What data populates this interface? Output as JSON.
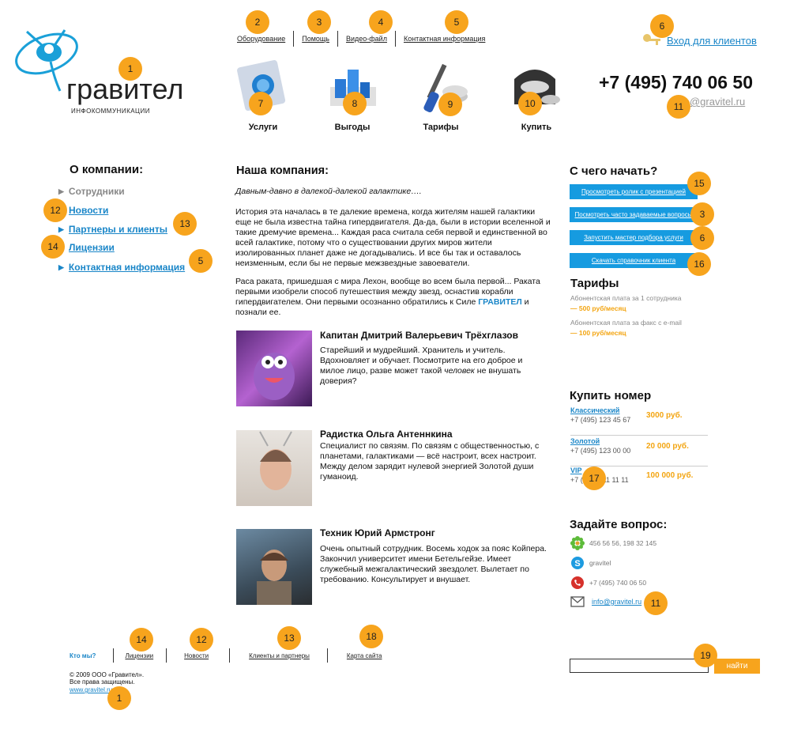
{
  "top_nav": [
    "Оборудование",
    "Помощь",
    "Видео-файл",
    "Контактная информация"
  ],
  "client_login": "Вход для клиентов",
  "logo": {
    "name": "гравител",
    "tagline": "ИНФОКОММУНИКАЦИИ"
  },
  "phone": "+7 (495) 740 06 50",
  "email_header": "info@gravitel.ru",
  "big_icons": [
    "Услуги",
    "Выгоды",
    "Тарифы",
    "Купить"
  ],
  "left_menu": {
    "title": "О компании:",
    "items": [
      "Сотрудники",
      "Новости",
      "Партнеры и клиенты",
      "Лицензии",
      "Контактная информация"
    ]
  },
  "main": {
    "title": "Наша компания:",
    "intro": "Давным-давно в далекой-далекой галактике….",
    "para1": "История эта началась в те далекие времена, когда жителям нашей галактики еще не была известна тайна гипердвигателя. Да-да, были в истории вселенной и такие дремучие времена... Каждая раса считала себя первой и единственной во всей галактике, потому что о существовании других миров жители изолированных планет даже не догадывались. И все бы так и оставалось неизменным, если бы не первые межзвездные завоеватели.",
    "para2_start": "Раса раката, пришедшая с мира Лехон, вообще во всем была первой... Раката первыми изобрели способ путешествия между звезд, оснастив корабли гипердвигателем. Они первыми осознанно обратились к Силе ",
    "para2_brand": "ГРАВИТЕЛ",
    "para2_end": " и познали ее.",
    "people": [
      {
        "name": "Капитан Дмитрий Валерьевич Трёхглазов",
        "text_a": "Старейший и мудрейший. Хранитель и учитель. Вдохновляет и обучает. Посмотрите на его доброе и милое лицо, разве может такой ",
        "text_em": "человек",
        "text_b": " не внушать доверия?"
      },
      {
        "name": "Радистка Ольга Антеннкина",
        "text_a": "Специалист по связям. По связям с общественностью, с планетами, галактиками — всё настроит, всех настроит. Между делом зарядит нулевой энергией  Золотой души гуманоид.",
        "text_em": "",
        "text_b": ""
      },
      {
        "name": "Техник Юрий Армстронг",
        "text_a": "Очень опытный сотрудник. Восемь ходок за пояс Койпера. Закончил университет имени Бетельгейзе. Имеет служебный межгалактический звездолет. Вылетает по требованию. Консультирует и внушает.",
        "text_em": "",
        "text_b": ""
      }
    ]
  },
  "right": {
    "start_title": "С чего начать?",
    "buttons": [
      "Просмотреть ролик с презентацией",
      "Посмотреть часто задаваемые вопросы",
      "Запустить мастер подбора услуги",
      "Скачать справочник клиента"
    ],
    "tariffs_title": "Тарифы",
    "tariffs": [
      {
        "label": "Абонентская плата за 1 сотрудника",
        "price": "— 500 руб/месяц"
      },
      {
        "label": "Абонентская плата за факс с e-mail",
        "price": "— 100 руб/месяц"
      }
    ],
    "buy_title": "Купить номер",
    "numbers": [
      {
        "type": "Классический",
        "number": "+7 (495) 123 45 67",
        "price": "3000 руб."
      },
      {
        "type": "Золотой",
        "number": "+7 (495) 123 00 00",
        "price": "20 000 руб."
      },
      {
        "type": "VIP",
        "number": "+7 (495) 111 11 11",
        "price": "100 000 руб."
      }
    ],
    "ask_title": "Задайте вопрос:",
    "contacts": [
      "456 56 56, 198 32 145",
      "gravitel",
      "+7 (495) 740 06 50",
      "info@gravitel.ru"
    ]
  },
  "footer": {
    "who": "Кто мы?",
    "links": [
      "Лицензии",
      "Новости",
      "Клиенты и партнеры",
      "Карта сайта"
    ],
    "copyright": "© 2009 ООО «Гравител».",
    "rights": "Все права защищены.",
    "site": "www.gravitel.ru",
    "search_button": "найти",
    "search_value": ""
  },
  "badges": [
    "1",
    "2",
    "3",
    "4",
    "5",
    "6",
    "7",
    "8",
    "9",
    "10",
    "11",
    "12",
    "13",
    "14",
    "5",
    "15",
    "3",
    "6",
    "16",
    "17",
    "11",
    "14",
    "12",
    "13",
    "18",
    "1",
    "19"
  ],
  "colors": {
    "accent": "#1a86c8",
    "button": "#169be0",
    "orange": "#f3a512",
    "badge": "#f7a41d"
  }
}
